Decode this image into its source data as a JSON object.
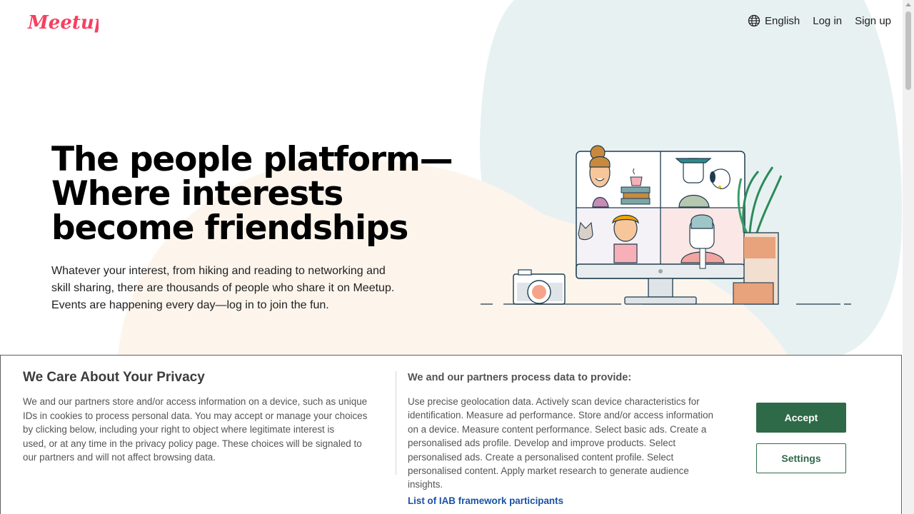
{
  "brand": {
    "logo_text": "Meetup",
    "color": "#f64060"
  },
  "header": {
    "language_label": "English",
    "login_label": "Log in",
    "signup_label": "Sign up"
  },
  "hero": {
    "title_lines": [
      "The people platform—",
      "Where interests",
      "become friendships"
    ],
    "body_lines": [
      "Whatever your interest, from hiking and reading to networking and",
      "skill sharing, there are thousands of people who share it on Meetup.",
      "Events are happening every day—log in to join the fun."
    ]
  },
  "consent": {
    "title": "We Care About Your Privacy",
    "body_lines": [
      "We and our partners store and/or access information on a device, such as unique",
      "IDs in cookies to process personal data. You may accept or manage your choices",
      "by clicking below, including your right to object where legitimate interest is",
      "used, or at any time in the privacy policy page. These choices will be signaled to",
      "our partners and will not affect browsing data."
    ],
    "purposes_title": "We and our partners process data to provide:",
    "purposes_lines": [
      "Use precise geolocation data. Actively scan device characteristics for",
      "identification. Measure ad performance. Store and/or access information",
      "on a device. Measure content performance. Select basic ads. Create a",
      "personalised ads profile. Develop and improve products. Select",
      "personalised ads. Create a personalised content profile. Select",
      "personalised content. Apply market research to generate audience",
      "insights."
    ],
    "iab_link_label": "List of IAB framework participants",
    "accept_label": "Accept",
    "settings_label": "Settings",
    "button_color": "#2f6a48"
  },
  "icons": {
    "language": "globe-icon"
  }
}
